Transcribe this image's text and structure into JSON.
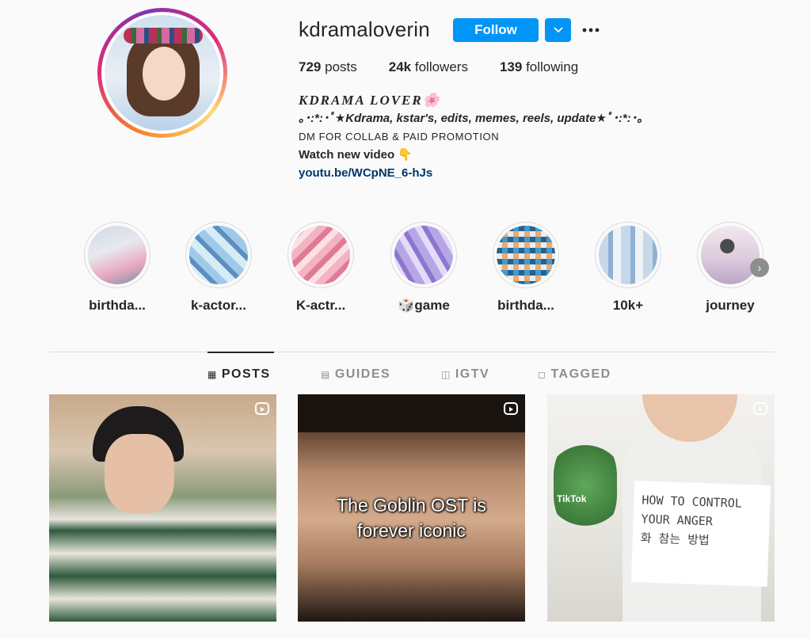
{
  "profile": {
    "username": "kdramaloverin",
    "follow_label": "Follow",
    "stats": {
      "posts_count": "729",
      "posts_label": "posts",
      "followers_count": "24k",
      "followers_label": "followers",
      "following_count": "139",
      "following_label": "following"
    },
    "bio": {
      "name": "KDRAMA LOVER🌸",
      "line2": "｡･:*:･ﾟ★Kdrama, kstar's, edits, memes, reels, update★ﾟ･:*:･｡",
      "line3": "DM FOR COLLAB & PAID PROMOTION",
      "line4": "Watch new video 👇",
      "link": "youtu.be/WCpNE_6-hJs"
    }
  },
  "highlights": [
    {
      "label": "birthda..."
    },
    {
      "label": "k-actor..."
    },
    {
      "label": "K-actr..."
    },
    {
      "label": "🎲game"
    },
    {
      "label": "birthda..."
    },
    {
      "label": "10k+"
    },
    {
      "label": "journey"
    }
  ],
  "tabs": [
    {
      "label": "POSTS",
      "icon": "grid-icon",
      "active": true
    },
    {
      "label": "GUIDES",
      "icon": "guide-icon",
      "active": false
    },
    {
      "label": "IGTV",
      "icon": "tv-icon",
      "active": false
    },
    {
      "label": "TAGGED",
      "icon": "tag-icon",
      "active": false
    }
  ],
  "posts": [
    {
      "type": "reel",
      "overlay": ""
    },
    {
      "type": "reel",
      "overlay": "The Goblin OST is\nforever iconic"
    },
    {
      "type": "reel",
      "overlay": "",
      "sign_text": "HOW TO CONTROL\nYOUR ANGER\n화 참는 방법",
      "watermark": "TikTok"
    }
  ],
  "colors": {
    "accent": "#0095f6",
    "link": "#00376b",
    "text": "#262626",
    "muted": "#8e8e8e",
    "background": "#fafafa"
  }
}
